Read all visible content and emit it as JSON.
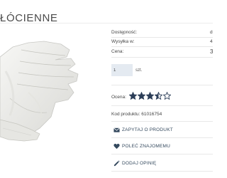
{
  "product": {
    "title": "ŁÓCIENNE"
  },
  "details": {
    "availability_label": "Dostępność:",
    "availability_value": "d",
    "shipping_label": "Wysyłka w:",
    "shipping_value": "4",
    "price_label": "Cena:",
    "price_value": "3"
  },
  "quantity": {
    "value": "1",
    "unit": "szt."
  },
  "rating": {
    "label": "Ocena:",
    "value": 3.5,
    "max": 5,
    "star_color": "#2c3e58"
  },
  "code": {
    "text": "Kod produktu: 61016754"
  },
  "actions": [
    {
      "label": "ZAPYTAJ O PRODUKT",
      "icon": "envelope-icon"
    },
    {
      "label": "POLEĆ ZNAJOMEMU",
      "icon": "heart-icon"
    },
    {
      "label": "DODAJ OPINIĘ",
      "icon": "pencil-icon"
    }
  ],
  "colors": {
    "accent": "#34495e",
    "input_bg": "#e4eaf1"
  }
}
